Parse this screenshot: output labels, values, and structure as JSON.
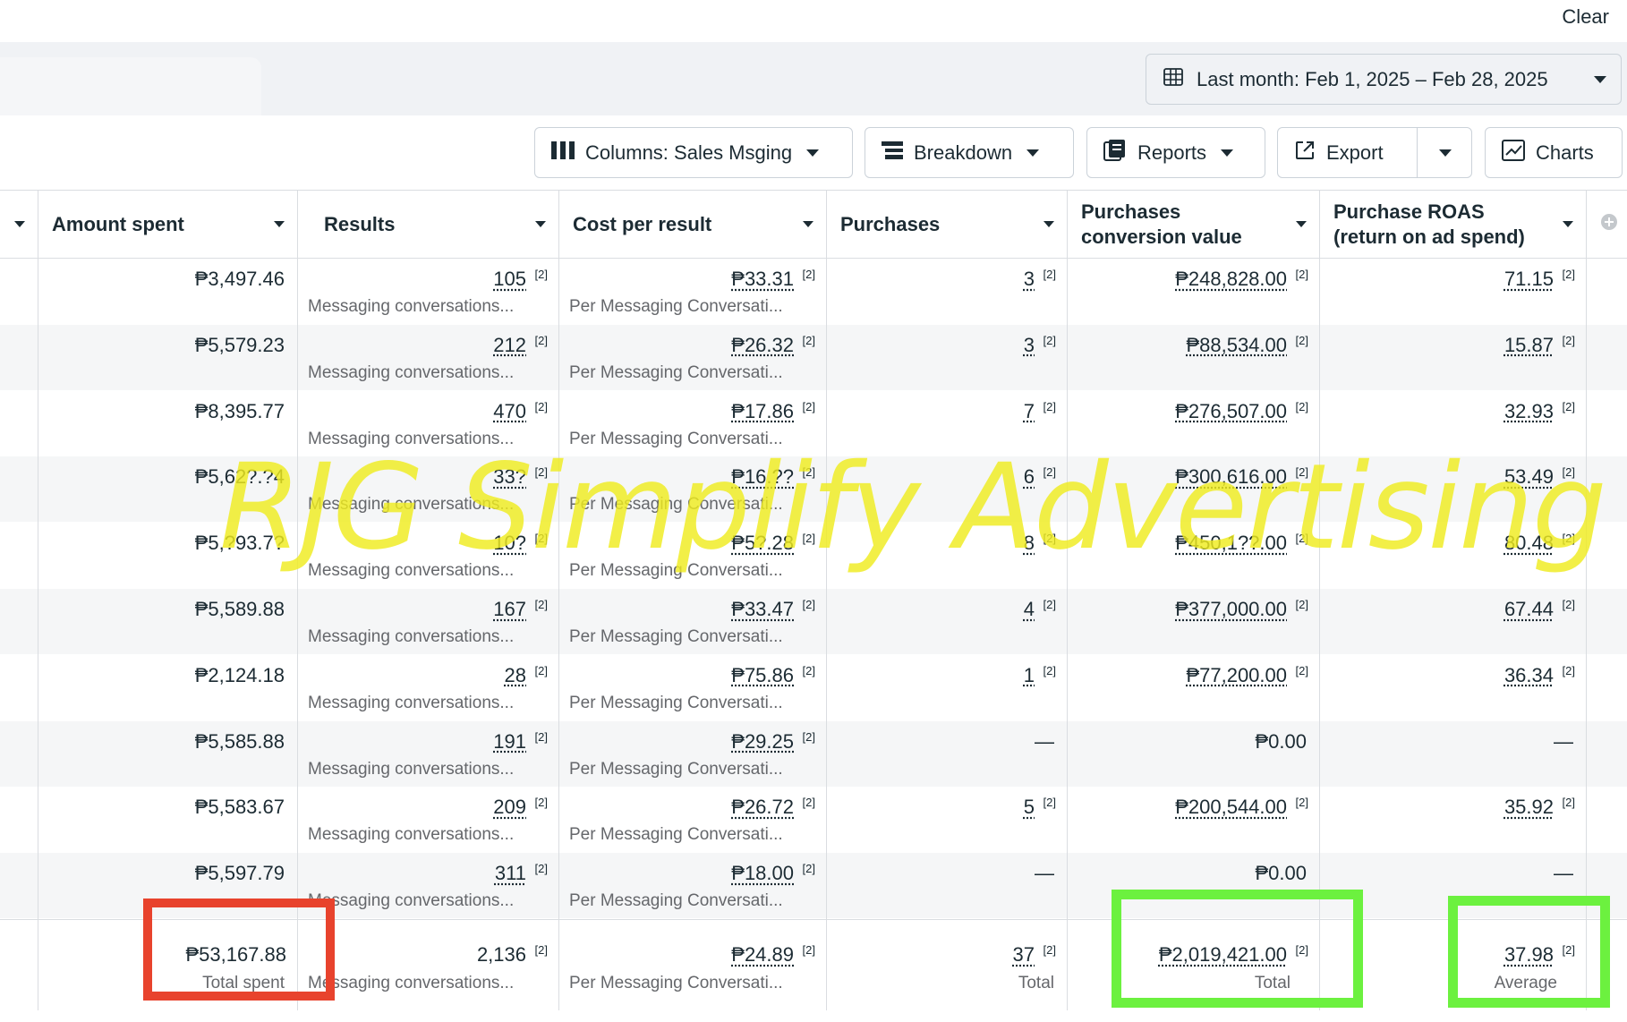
{
  "topbar": {
    "clear_label": "Clear"
  },
  "date_range": {
    "label": "Last month: Feb 1, 2025 – Feb 28, 2025"
  },
  "toolbar": {
    "columns_label": "Columns: Sales Msging",
    "breakdown_label": "Breakdown",
    "reports_label": "Reports",
    "export_label": "Export",
    "charts_label": "Charts"
  },
  "table": {
    "columns": [
      {
        "line1": "Amount spent",
        "line2": ""
      },
      {
        "line1": "Results",
        "line2": ""
      },
      {
        "line1": "Cost per result",
        "line2": ""
      },
      {
        "line1": "Purchases",
        "line2": ""
      },
      {
        "line1": "Purchases",
        "line2": "conversion value"
      },
      {
        "line1": "Purchase ROAS",
        "line2": "(return on ad spend)"
      }
    ],
    "ref_mark": "[2]",
    "results_sub": "Messaging conversations...",
    "cpr_sub": "Per Messaging Conversati...",
    "rows": [
      {
        "spent": "₱3,497.46",
        "results": "105",
        "cpr": "₱33.31",
        "purchases": "3",
        "conv_value": "₱248,828.00",
        "roas": "71.15"
      },
      {
        "spent": "₱5,579.23",
        "results": "212",
        "cpr": "₱26.32",
        "purchases": "3",
        "conv_value": "₱88,534.00",
        "roas": "15.87"
      },
      {
        "spent": "₱8,395.77",
        "results": "470",
        "cpr": "₱17.86",
        "purchases": "7",
        "conv_value": "₱276,507.00",
        "roas": "32.93"
      },
      {
        "spent": "₱5,62?.?4",
        "results": "33?",
        "cpr": "₱16.??",
        "purchases": "6",
        "conv_value": "₱300,616.00",
        "roas": "53.49"
      },
      {
        "spent": "₱5,?93.7?",
        "results": "10?",
        "cpr": "₱5?.28",
        "purchases": "8",
        "conv_value": "₱450,1??.00",
        "roas": "80.48"
      },
      {
        "spent": "₱5,589.88",
        "results": "167",
        "cpr": "₱33.47",
        "purchases": "4",
        "conv_value": "₱377,000.00",
        "roas": "67.44"
      },
      {
        "spent": "₱2,124.18",
        "results": "28",
        "cpr": "₱75.86",
        "purchases": "1",
        "conv_value": "₱77,200.00",
        "roas": "36.34"
      },
      {
        "spent": "₱5,585.88",
        "results": "191",
        "cpr": "₱29.25",
        "purchases": "—",
        "conv_value": "₱0.00",
        "roas": "—"
      },
      {
        "spent": "₱5,583.67",
        "results": "209",
        "cpr": "₱26.72",
        "purchases": "5",
        "conv_value": "₱200,544.00",
        "roas": "35.92"
      },
      {
        "spent": "₱5,597.79",
        "results": "311",
        "cpr": "₱18.00",
        "purchases": "—",
        "conv_value": "₱0.00",
        "roas": "—"
      }
    ],
    "totals": {
      "spent": "₱53,167.88",
      "spent_sub": "Total spent",
      "results": "2,136",
      "results_sub": "Messaging conversations...",
      "cpr": "₱24.89",
      "cpr_sub": "Per Messaging Conversati...",
      "purchases": "37",
      "purchases_sub": "Total",
      "conv_value": "₱2,019,421.00",
      "conv_value_sub": "Total",
      "roas": "37.98",
      "roas_sub": "Average"
    }
  },
  "watermark": {
    "text": "RJG Simplify Advertising",
    "color": "#efec1e"
  },
  "highlights": {
    "red": "#e8432d",
    "green": "#6cf13f"
  }
}
